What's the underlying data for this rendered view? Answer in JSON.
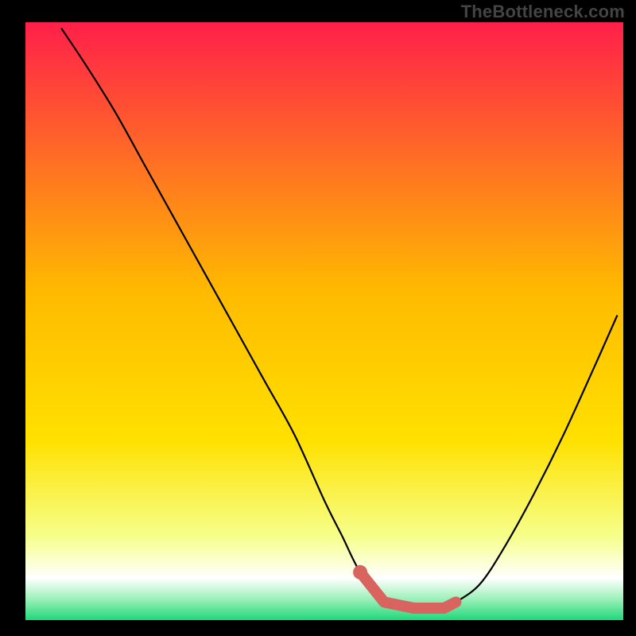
{
  "watermark": "TheBottleneck.com",
  "colors": {
    "background": "#000000",
    "gradient_top": "#ff1f4a",
    "gradient_mid": "#ffd400",
    "gradient_nearbottom": "#f6ff8a",
    "gradient_bottom_white": "#ffffff",
    "gradient_bottom_green": "#1fd87a",
    "curve": "#000000",
    "marker": "#d9645f"
  },
  "chart_data": {
    "type": "line",
    "title": "",
    "xlabel": "",
    "ylabel": "",
    "xlim": [
      0,
      100
    ],
    "ylim": [
      0,
      100
    ],
    "series": [
      {
        "name": "bottleneck-curve",
        "x": [
          6,
          10,
          15,
          20,
          25,
          30,
          35,
          40,
          45,
          50,
          53,
          56,
          60,
          65,
          70,
          72,
          76,
          80,
          85,
          90,
          95,
          99
        ],
        "y": [
          99,
          93,
          85,
          76,
          67,
          58,
          49,
          40,
          31,
          20,
          14,
          8,
          3,
          2,
          2,
          3,
          6,
          12,
          21,
          31,
          42,
          51
        ]
      }
    ],
    "annotations": {
      "optimal_range_x": [
        56,
        72
      ],
      "optimal_marker_points": [
        {
          "x": 56,
          "y": 8
        },
        {
          "x": 60,
          "y": 3
        },
        {
          "x": 65,
          "y": 2
        },
        {
          "x": 70,
          "y": 2
        },
        {
          "x": 72,
          "y": 3
        }
      ]
    }
  }
}
